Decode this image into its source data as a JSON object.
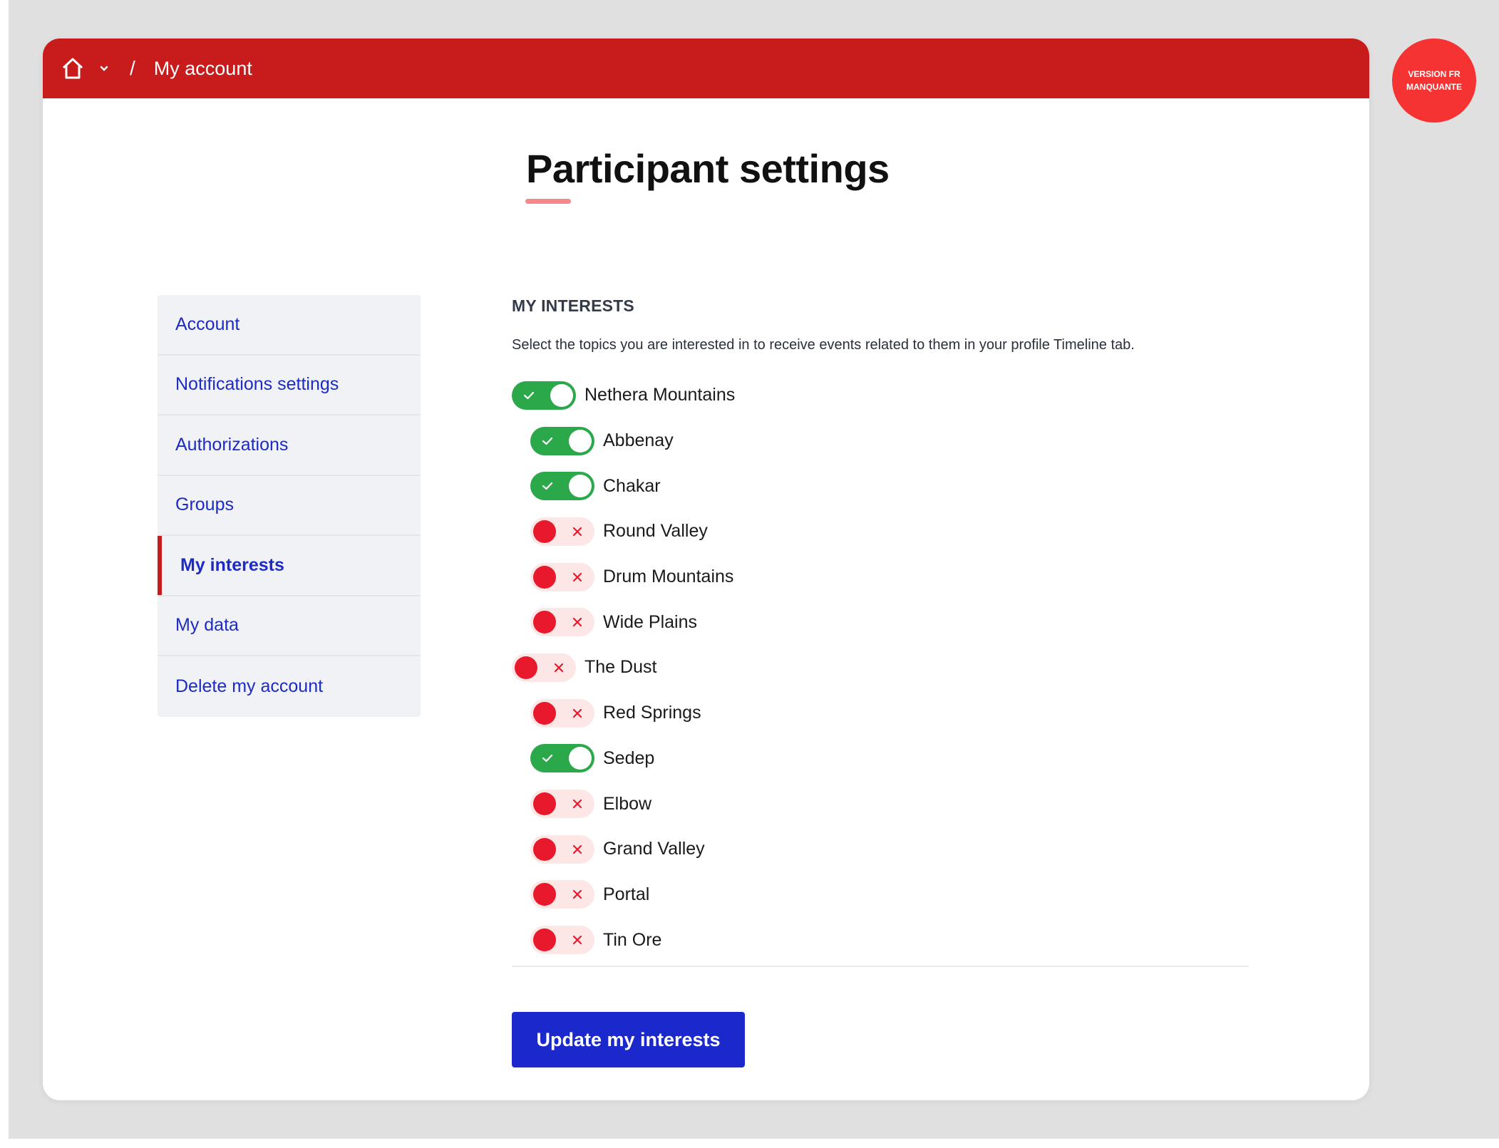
{
  "breadcrumb": {
    "separator": "/",
    "current": "My account"
  },
  "badge": {
    "line1": "VERSION FR",
    "line2": "MANQUANTE"
  },
  "page": {
    "title": "Participant settings"
  },
  "sidebar": {
    "items": [
      {
        "label": "Account",
        "active": false
      },
      {
        "label": "Notifications settings",
        "active": false
      },
      {
        "label": "Authorizations",
        "active": false
      },
      {
        "label": "Groups",
        "active": false
      },
      {
        "label": "My interests",
        "active": true
      },
      {
        "label": "My data",
        "active": false
      },
      {
        "label": "Delete my account",
        "active": false
      }
    ]
  },
  "interests": {
    "title": "MY INTERESTS",
    "description": "Select the topics you are interested in to receive events related to them in your profile Timeline tab.",
    "items": [
      {
        "label": "Nethera Mountains",
        "checked": true,
        "level": 0
      },
      {
        "label": "Abbenay",
        "checked": true,
        "level": 1
      },
      {
        "label": "Chakar",
        "checked": true,
        "level": 1
      },
      {
        "label": "Round Valley",
        "checked": false,
        "level": 1
      },
      {
        "label": "Drum Mountains",
        "checked": false,
        "level": 1
      },
      {
        "label": "Wide Plains",
        "checked": false,
        "level": 1
      },
      {
        "label": "The Dust",
        "checked": false,
        "level": 0
      },
      {
        "label": "Red Springs",
        "checked": false,
        "level": 1
      },
      {
        "label": "Sedep",
        "checked": true,
        "level": 1
      },
      {
        "label": "Elbow",
        "checked": false,
        "level": 1
      },
      {
        "label": "Grand Valley",
        "checked": false,
        "level": 1
      },
      {
        "label": "Portal",
        "checked": false,
        "level": 1
      },
      {
        "label": "Tin Ore",
        "checked": false,
        "level": 1
      }
    ],
    "submit_label": "Update my interests"
  },
  "colors": {
    "brand_red": "#c81b1b",
    "toggle_on": "#2aa84a",
    "toggle_off_knob": "#e8192c",
    "link_blue": "#1d2bc4",
    "button_blue": "#1a28cc"
  }
}
